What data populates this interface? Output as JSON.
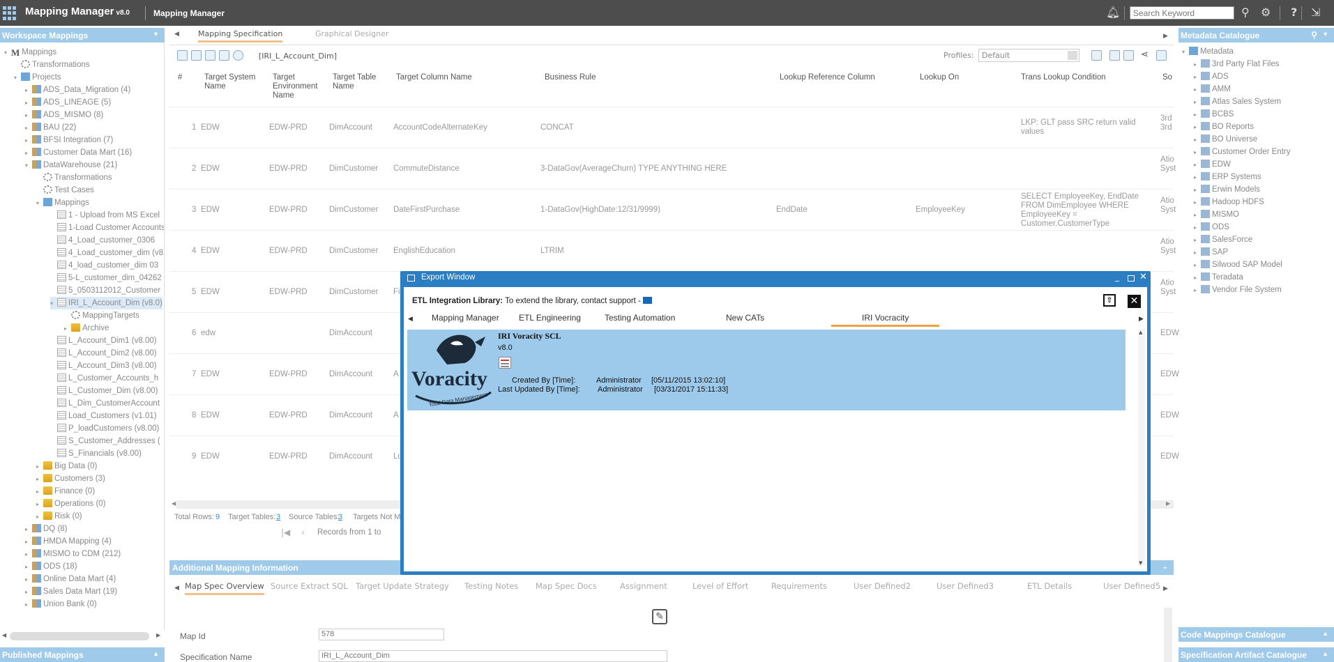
{
  "header": {
    "app_title": "Mapping Manager",
    "app_version": "v8.0",
    "subtitle": "Mapping Manager",
    "search_placeholder": "Search Keyword"
  },
  "left_panel": {
    "title": "Workspace Mappings",
    "published": "Published Mappings",
    "tree": [
      {
        "label": "Mappings",
        "level": 0,
        "icon": "m",
        "tog": "▾"
      },
      {
        "label": "Transformations",
        "level": 1,
        "icon": "gear",
        "tog": ""
      },
      {
        "label": "Projects",
        "level": 1,
        "icon": "proj",
        "tog": "▾"
      },
      {
        "label": "ADS_Data_Migration (4)",
        "level": 2,
        "icon": "stack",
        "tog": "▸"
      },
      {
        "label": "ADS_LINEAGE (5)",
        "level": 2,
        "icon": "stack",
        "tog": "▸"
      },
      {
        "label": "ADS_MISMO (8)",
        "level": 2,
        "icon": "stack",
        "tog": "▸"
      },
      {
        "label": "BAU (22)",
        "level": 2,
        "icon": "stack",
        "tog": "▸"
      },
      {
        "label": "BFSI Integration (7)",
        "level": 2,
        "icon": "stack",
        "tog": "▸"
      },
      {
        "label": "Customer Data Mart (16)",
        "level": 2,
        "icon": "stack",
        "tog": "▸"
      },
      {
        "label": "DataWarehouse (21)",
        "level": 2,
        "icon": "stack",
        "tog": "▾"
      },
      {
        "label": "Transformations",
        "level": 3,
        "icon": "gear",
        "tog": ""
      },
      {
        "label": "Test Cases",
        "level": 3,
        "icon": "gear",
        "tog": ""
      },
      {
        "label": "Mappings",
        "level": 3,
        "icon": "proj",
        "tog": "▾"
      },
      {
        "label": "1 - Upload from MS Excel",
        "level": 4,
        "icon": "table",
        "tog": ""
      },
      {
        "label": "1-Load Customer Accounts",
        "level": 4,
        "icon": "table",
        "tog": ""
      },
      {
        "label": "4_Load_customer_0306",
        "level": 4,
        "icon": "table",
        "tog": ""
      },
      {
        "label": "4_Load_customer_dim (v8.0)",
        "level": 4,
        "icon": "table",
        "tog": ""
      },
      {
        "label": "4_load_customer_dim 03",
        "level": 4,
        "icon": "table",
        "tog": ""
      },
      {
        "label": "5-L_customer_dim_04262",
        "level": 4,
        "icon": "table",
        "tog": ""
      },
      {
        "label": "5_0503112012_Customer",
        "level": 4,
        "icon": "table",
        "tog": ""
      },
      {
        "label": "IRI_L_Account_Dim (v8.0)",
        "level": 4,
        "icon": "table",
        "tog": "▾",
        "selected": true
      },
      {
        "label": "MappingTargets",
        "level": 5,
        "icon": "gear",
        "tog": ""
      },
      {
        "label": "Archive",
        "level": 5,
        "icon": "folder",
        "tog": "▸"
      },
      {
        "label": "L_Account_Dim1 (v8.00)",
        "level": 4,
        "icon": "table",
        "tog": ""
      },
      {
        "label": "L_Account_Dim2 (v8.00)",
        "level": 4,
        "icon": "table",
        "tog": ""
      },
      {
        "label": "L_Account_Dim3 (v8.00)",
        "level": 4,
        "icon": "table",
        "tog": ""
      },
      {
        "label": "L_Customer_Accounts_h",
        "level": 4,
        "icon": "table",
        "tog": ""
      },
      {
        "label": "L_Customer_Dim (v8.00)",
        "level": 4,
        "icon": "table",
        "tog": ""
      },
      {
        "label": "L_Dim_CustomerAccount",
        "level": 4,
        "icon": "table",
        "tog": ""
      },
      {
        "label": "Load_Customers (v1.01)",
        "level": 4,
        "icon": "table",
        "tog": ""
      },
      {
        "label": "P_loadCustomers (v8.00)",
        "level": 4,
        "icon": "table",
        "tog": ""
      },
      {
        "label": "S_Customer_Addresses (",
        "level": 4,
        "icon": "table",
        "tog": ""
      },
      {
        "label": "S_Financials (v8.00)",
        "level": 4,
        "icon": "table",
        "tog": ""
      },
      {
        "label": "Big Data (0)",
        "level": 3,
        "icon": "folder",
        "tog": "▸"
      },
      {
        "label": "Customers (3)",
        "level": 3,
        "icon": "folder",
        "tog": "▸"
      },
      {
        "label": "Finance (0)",
        "level": 3,
        "icon": "folder",
        "tog": "▸"
      },
      {
        "label": "Operations (0)",
        "level": 3,
        "icon": "folder",
        "tog": "▸"
      },
      {
        "label": "Risk (0)",
        "level": 3,
        "icon": "folder",
        "tog": "▸"
      },
      {
        "label": "DQ (8)",
        "level": 2,
        "icon": "stack",
        "tog": "▸"
      },
      {
        "label": "HMDA Mapping (4)",
        "level": 2,
        "icon": "stack",
        "tog": "▸"
      },
      {
        "label": "MISMO to CDM (212)",
        "level": 2,
        "icon": "stack",
        "tog": "▸"
      },
      {
        "label": "ODS (18)",
        "level": 2,
        "icon": "stack",
        "tog": "▸"
      },
      {
        "label": "Online Data Mart (4)",
        "level": 2,
        "icon": "stack",
        "tog": "▸"
      },
      {
        "label": "Sales Data Mart (19)",
        "level": 2,
        "icon": "stack",
        "tog": "▸"
      },
      {
        "label": "Union Bank (0)",
        "level": 2,
        "icon": "stack",
        "tog": "▸"
      }
    ]
  },
  "main": {
    "tabs": [
      "Mapping Specification",
      "Graphical Designer"
    ],
    "toolbar_label": "[IRI_L_Account_Dim]",
    "profiles_label": "Profiles:",
    "profile_value": "Default",
    "columns": [
      "#",
      "Target System Name",
      "Target Environment Name",
      "Target Table Name",
      "Target Column Name",
      "Business Rule",
      "Lookup Reference Column",
      "Lookup On",
      "Trans Lookup Condition",
      "So"
    ],
    "rows": [
      [
        "1",
        "EDW",
        "EDW-PRD",
        "DimAccount",
        "AccountCodeAlternateKey",
        "CONCAT",
        "",
        "",
        "LKP: GLT pass SRC return valid values",
        "3rd 3rd"
      ],
      [
        "2",
        "EDW",
        "EDW-PRD",
        "DimCustomer",
        "CommuteDistance",
        "3-DataGov(AverageChurn) TYPE ANYTHING HERE",
        "",
        "",
        "",
        "Atio Syst"
      ],
      [
        "3",
        "EDW",
        "EDW-PRD",
        "DimCustomer",
        "DateFirstPurchase",
        "1-DataGov(HighDate:12/31/9999)",
        "EndDate",
        "EmployeeKey",
        "SELECT EmployeeKey, EndDate FROM DimEmployee WHERE EmployeeKey = Customer.CustomerType",
        "Atio Syst"
      ],
      [
        "4",
        "EDW",
        "EDW-PRD",
        "DimCustomer",
        "EnglishEducation",
        "LTRIM",
        "",
        "",
        "",
        "Atio Syst"
      ],
      [
        "5",
        "EDW",
        "EDW-PRD",
        "DimCustomer",
        "Fi",
        "",
        "",
        "",
        "",
        "Atio Syst"
      ],
      [
        "6",
        "edw",
        "",
        "DimAccount",
        "",
        "",
        "",
        "",
        "",
        "EDW"
      ],
      [
        "7",
        "EDW",
        "EDW-PRD",
        "DimAccount",
        "A",
        "",
        "",
        "",
        "",
        "EDW"
      ],
      [
        "8",
        "EDW",
        "EDW-PRD",
        "DimAccount",
        "A",
        "",
        "",
        "",
        "",
        "EDW"
      ],
      [
        "9",
        "EDW",
        "EDW-PRD",
        "DimAccount",
        "Lo",
        "",
        "",
        "",
        "",
        "EDW"
      ]
    ],
    "footer": {
      "total_rows_label": "Total Rows:",
      "total_rows": "9",
      "target_tables_label": "Target Tables:",
      "target_tables": "3",
      "source_tables_label": "Source Tables:",
      "source_tables": "3",
      "targets_not": "Targets Not M"
    },
    "pager": "Records from 1 to",
    "additional": {
      "title": "Additional Mapping Information",
      "tabs": [
        "Map Spec Overview",
        "Source Extract SQL",
        "Target Update Strategy",
        "Testing Notes",
        "Map Spec Docs",
        "Assignment",
        "Level of Effort",
        "Requirements",
        "User Defined2",
        "User Defined3",
        "ETL Details",
        "User Defined5"
      ],
      "map_id_label": "Map Id",
      "map_id": "578",
      "spec_name_label": "Specification Name",
      "spec_name": "IRI_L_Account_Dim"
    }
  },
  "right_panel": {
    "title": "Metadata Catalogue",
    "root": "Metadata",
    "items": [
      "3rd Party Flat Files",
      "ADS",
      "AMM",
      "Atlas Sales System",
      "BCBS",
      "BO Reports",
      "BO Universe",
      "Customer Order Entry",
      "EDW",
      "ERP Systems",
      "Erwin Models",
      "Hadoop HDFS",
      "MISMO",
      "ODS",
      "SalesForce",
      "SAP",
      "Silwood SAP Model",
      "Teradata",
      "Vendor File System"
    ],
    "code_catalogue": "Code Mappings Catalogue",
    "artifact_catalogue": "Specification Artifact Catalogue"
  },
  "export_window": {
    "title": "Export Window",
    "library_label": "ETL Integration Library:",
    "library_text": " To extend the library, contact support - ",
    "tabs": [
      "Mapping Manager",
      "ETL Engineering",
      "Testing Automation",
      "New CATs",
      "IRI Vocracity"
    ],
    "card": {
      "name": "IRI Voracity SCL",
      "version": "v8.0",
      "logo_word": "Voracity",
      "logo_tag": "Total Data Management",
      "created_label": "Created By [Time]:",
      "created_by": "Administrator",
      "created_time": "[05/11/2015 13:02:10]",
      "updated_label": "Last Updated By [Time]:",
      "updated_by": "Administrator",
      "updated_time": "[03/31/2017 15:11:33]"
    }
  }
}
